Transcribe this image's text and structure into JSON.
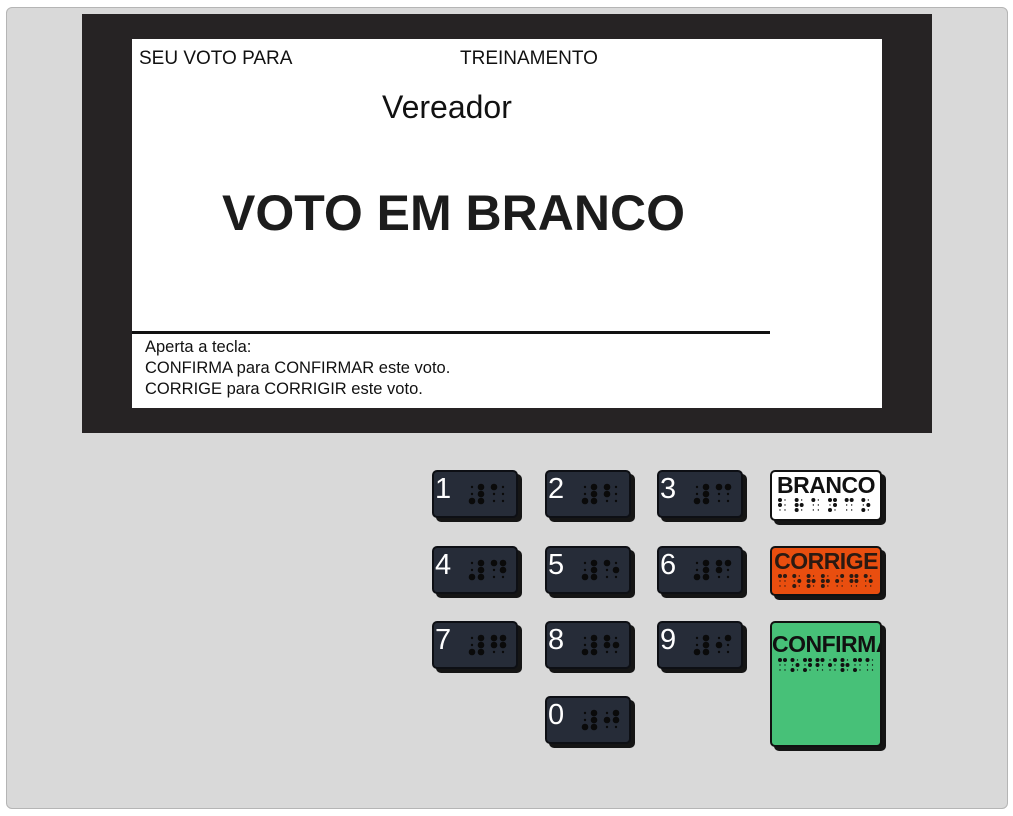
{
  "screen": {
    "header_left": "SEU VOTO PARA",
    "header_center": "TREINAMENTO",
    "office": "Vereador",
    "vote_status": "VOTO EM BRANCO",
    "instructions": [
      "Aperta a tecla:",
      "CONFIRMA para CONFIRMAR este voto.",
      "CORRIGE para CORRIGIR este voto."
    ]
  },
  "keypad": {
    "keys": [
      "1",
      "2",
      "3",
      "4",
      "5",
      "6",
      "7",
      "8",
      "9",
      "0"
    ]
  },
  "actions": {
    "branco": "BRANCO",
    "corrige": "CORRIGE",
    "confirma": "CONFIRMA"
  },
  "colors": {
    "frame": "#262324",
    "key": "#262c38",
    "branco": "#ffffff",
    "corrige": "#e94e0f",
    "confirma": "#47c178",
    "body": "#d9d9d9"
  }
}
